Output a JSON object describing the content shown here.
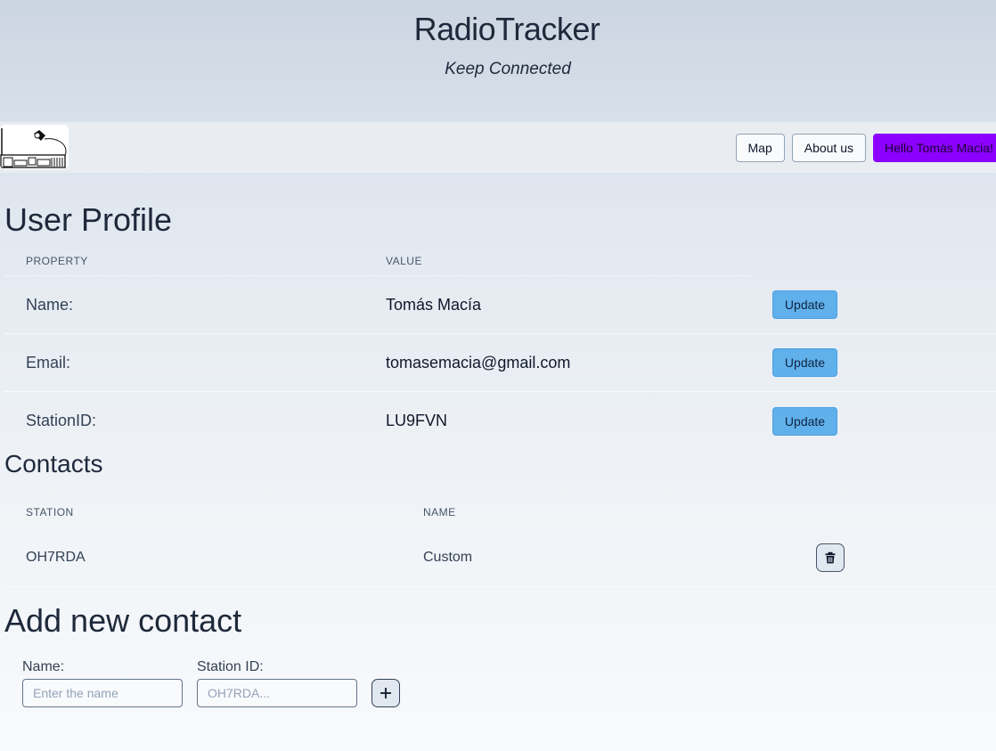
{
  "header": {
    "title": "RadioTracker",
    "tagline": "Keep Connected"
  },
  "nav": {
    "map": "Map",
    "about": "About us",
    "user": "Hello Tomás Macia!"
  },
  "profile": {
    "title": "User Profile",
    "col_property": "PROPERTY",
    "col_value": "VALUE",
    "rows": [
      {
        "property": "Name:",
        "value": "Tomás Macía",
        "action": "Update"
      },
      {
        "property": "Email:",
        "value": "tomasemacia@gmail.com",
        "action": "Update"
      },
      {
        "property": "StationID:",
        "value": "LU9FVN",
        "action": "Update"
      }
    ]
  },
  "contacts": {
    "title": "Contacts",
    "col_station": "STATION",
    "col_name": "NAME",
    "rows": [
      {
        "station": "OH7RDA",
        "name": "Custom"
      }
    ]
  },
  "add_contact": {
    "title": "Add new contact",
    "name_label": "Name:",
    "name_placeholder": "Enter the name",
    "station_label": "Station ID:",
    "station_placeholder": "OH7RDA..."
  },
  "colors": {
    "accent": "#8b00ff",
    "update_button": "#60b0ec"
  },
  "icons": {
    "delete": "trash-icon",
    "add": "plus-icon",
    "logo": "radio-logo"
  }
}
